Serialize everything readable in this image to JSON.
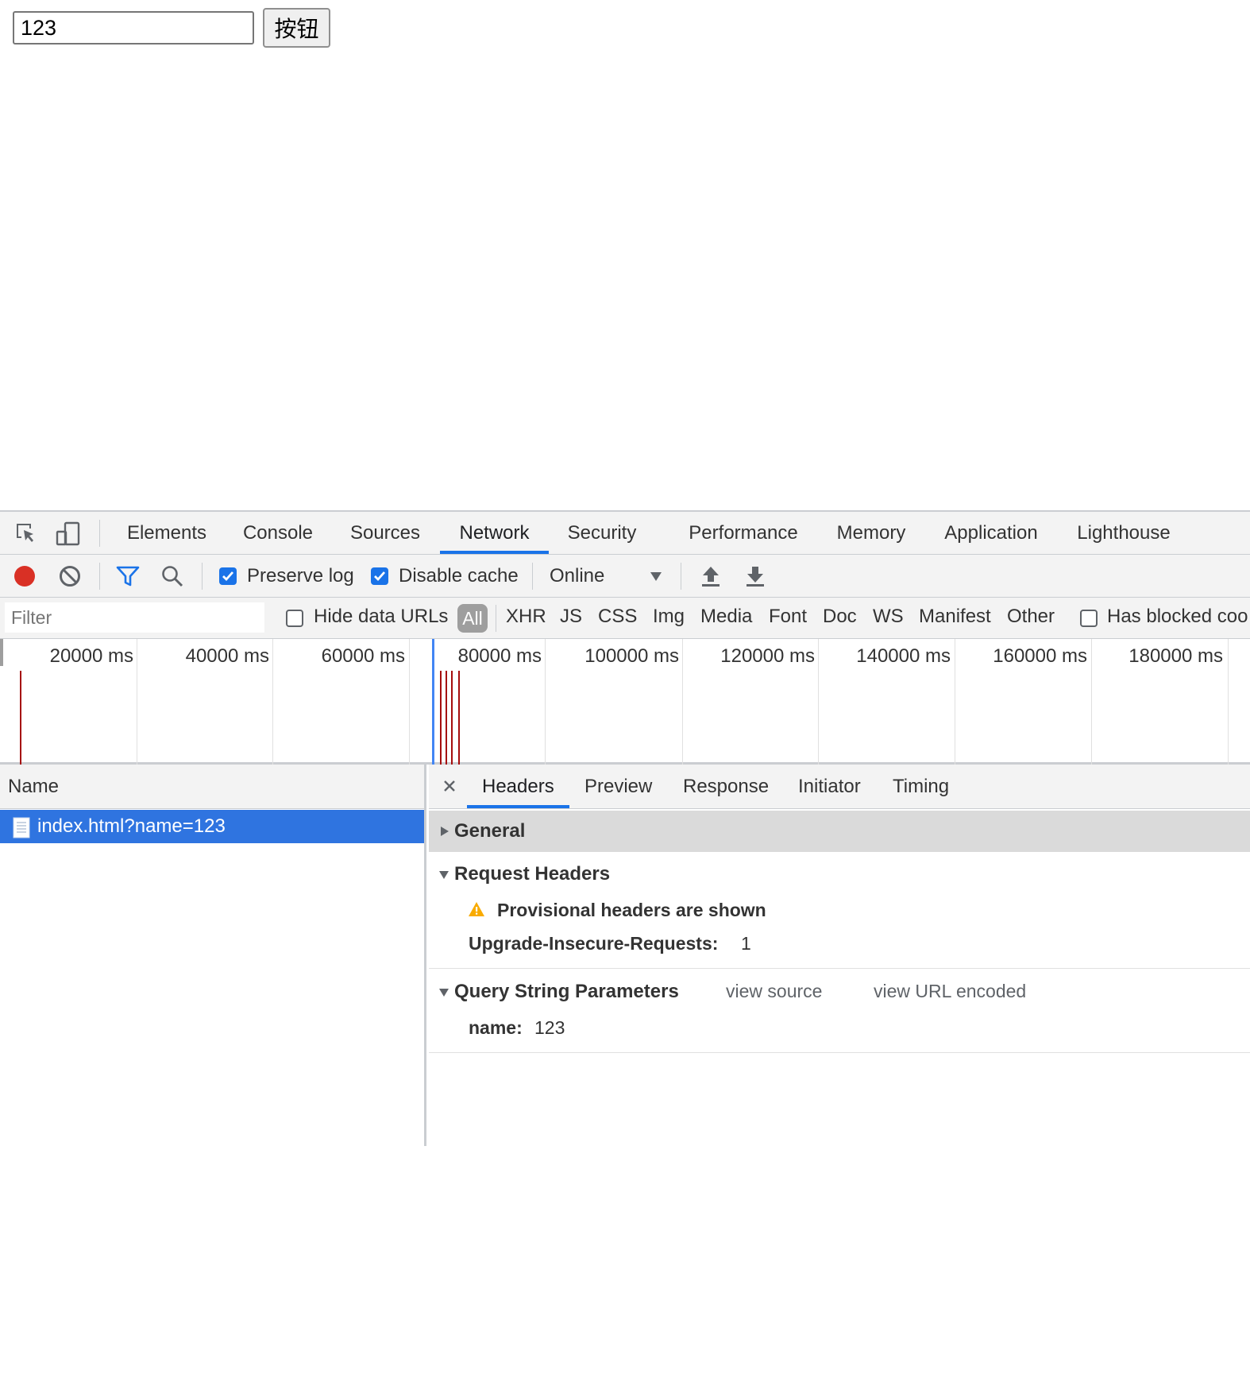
{
  "page": {
    "input_value": "123",
    "button_label": "按钮"
  },
  "devtools": {
    "tabs": [
      "Elements",
      "Console",
      "Sources",
      "Network",
      "Security",
      "Performance",
      "Memory",
      "Application",
      "Lighthouse"
    ],
    "active_tab": "Network",
    "toolbar": {
      "preserve_log_label": "Preserve log",
      "preserve_log_checked": true,
      "disable_cache_label": "Disable cache",
      "disable_cache_checked": true,
      "throttling_value": "Online"
    },
    "filter": {
      "placeholder": "Filter",
      "hide_data_urls_label": "Hide data URLs",
      "types": [
        "All",
        "XHR",
        "JS",
        "CSS",
        "Img",
        "Media",
        "Font",
        "Doc",
        "WS",
        "Manifest",
        "Other"
      ],
      "active_type": "All",
      "has_blocked_label": "Has blocked coo"
    },
    "overview": {
      "ticks": [
        "20000 ms",
        "40000 ms",
        "60000 ms",
        "80000 ms",
        "100000 ms",
        "120000 ms",
        "140000 ms",
        "160000 ms",
        "180000 ms"
      ]
    },
    "requests": {
      "column_name": "Name",
      "rows": [
        {
          "name": "index.html?name=123",
          "selected": true
        }
      ]
    },
    "details": {
      "tabs": [
        "Headers",
        "Preview",
        "Response",
        "Initiator",
        "Timing"
      ],
      "active_tab": "Headers",
      "general_title": "General",
      "request_headers_title": "Request Headers",
      "provisional_warning": "Provisional headers are shown",
      "request_headers": [
        {
          "key": "Upgrade-Insecure-Requests:",
          "value": "1"
        }
      ],
      "query_title": "Query String Parameters",
      "view_source": "view source",
      "view_url_encoded": "view URL encoded",
      "query_params": [
        {
          "key": "name:",
          "value": "123"
        }
      ]
    }
  }
}
